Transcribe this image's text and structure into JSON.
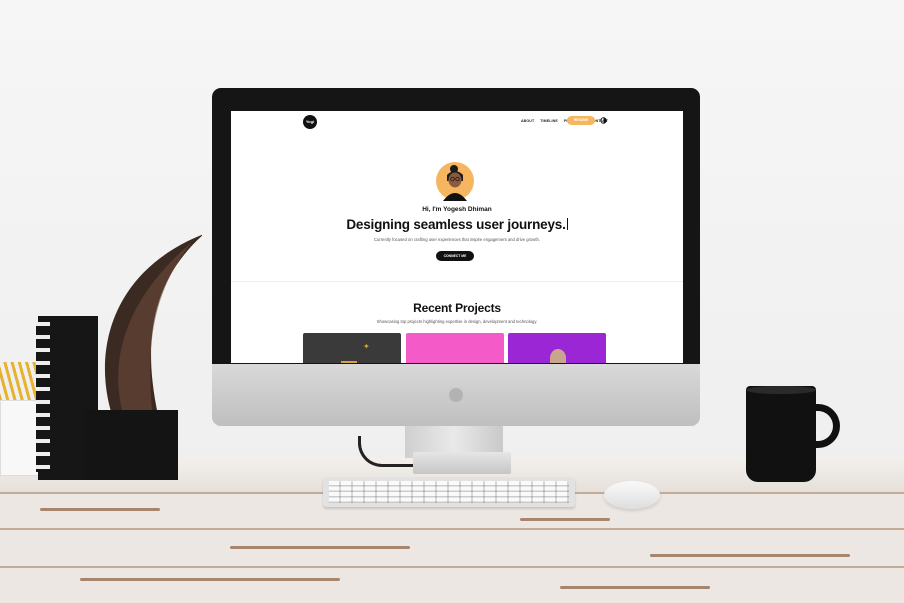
{
  "site": {
    "logo_text": "Yogi",
    "nav_links": [
      "ABOUT",
      "TIMELINE",
      "PROJECTS",
      "CONTACT"
    ],
    "nav_cta": "RESUME",
    "hero": {
      "greeting": "Hi, I'm Yogesh Dhiman",
      "headline": "Designing seamless user journeys.",
      "subtitle": "Currently focused on crafting user experiences that inspire engagement and drive growth.",
      "cta": "CONNECT ME"
    },
    "projects": {
      "title": "Recent Projects",
      "subtitle": "Showcasing top projects highlighting expertise in design, development and technology."
    }
  },
  "colors": {
    "accent_orange": "#f6b660",
    "card_dark": "#3a3a3a",
    "card_pink": "#f45bc8",
    "card_purple": "#9b26d6"
  },
  "icons": {
    "theme_toggle": "moon-icon",
    "avatar": "avatar-illustration"
  }
}
